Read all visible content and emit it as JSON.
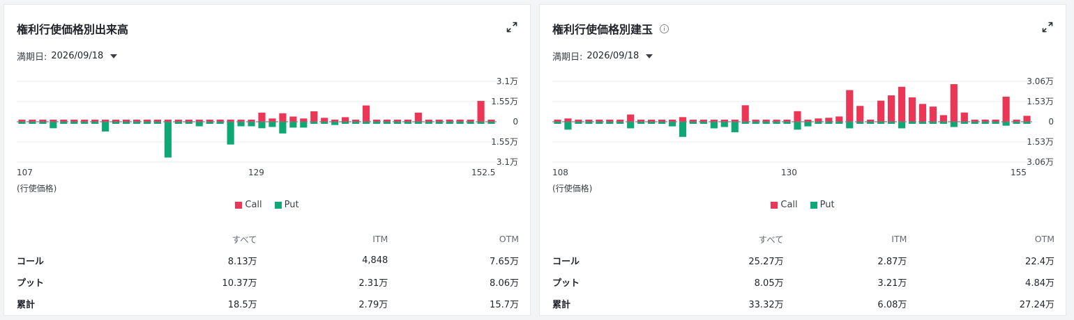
{
  "colors": {
    "call": "#ec3655",
    "put": "#0fa875",
    "grid": "#e9ebee",
    "zero": "#7a7f85"
  },
  "panels": [
    {
      "title": "権利行使価格別出来高",
      "has_info_icon": false,
      "expiry_label": "満期日:",
      "expiry_value": "2026/09/18",
      "x_unit": "(行使価格)",
      "legend_call": "Call",
      "legend_put": "Put",
      "table": {
        "headers": [
          "",
          "すべて",
          "ITM",
          "OTM"
        ],
        "rows": [
          {
            "label": "コール",
            "all": "8.13万",
            "itm": "4,848",
            "otm": "7.65万"
          },
          {
            "label": "プット",
            "all": "10.37万",
            "itm": "2.31万",
            "otm": "8.06万"
          },
          {
            "label": "累計",
            "all": "18.5万",
            "itm": "2.79万",
            "otm": "15.7万"
          }
        ]
      }
    },
    {
      "title": "権利行使価格別建玉",
      "has_info_icon": true,
      "expiry_label": "満期日:",
      "expiry_value": "2026/09/18",
      "x_unit": "(行使価格)",
      "legend_call": "Call",
      "legend_put": "Put",
      "table": {
        "headers": [
          "",
          "すべて",
          "ITM",
          "OTM"
        ],
        "rows": [
          {
            "label": "コール",
            "all": "25.27万",
            "itm": "2.87万",
            "otm": "22.4万"
          },
          {
            "label": "プット",
            "all": "8.05万",
            "itm": "3.21万",
            "otm": "4.84万"
          },
          {
            "label": "累計",
            "all": "33.32万",
            "itm": "6.08万",
            "otm": "27.24万"
          }
        ]
      }
    }
  ],
  "chart_data": [
    {
      "type": "bar",
      "title": "権利行使価格別出来高",
      "xlabel": "(行使価格)",
      "x_tick_labels": [
        "107",
        "129",
        "152.5"
      ],
      "y_tick_labels": [
        "3.1万",
        "1.55万",
        "0",
        "1.55万",
        "3.1万"
      ],
      "ylim": [
        -31000,
        31000
      ],
      "series": [
        {
          "name": "Call",
          "values": [
            0,
            0,
            0,
            0,
            0,
            0,
            0,
            0,
            0,
            0,
            0,
            0,
            0,
            0,
            0,
            0,
            0,
            0,
            0,
            0,
            0,
            0,
            0,
            7000,
            2500,
            6500,
            4000,
            2500,
            8000,
            3000,
            1500,
            3500,
            1000,
            12500,
            0,
            0,
            0,
            0,
            7000,
            0,
            0,
            0,
            0,
            0,
            16000,
            0
          ]
        },
        {
          "name": "Put",
          "values": [
            0,
            0,
            0,
            -5000,
            0,
            0,
            0,
            0,
            -7500,
            0,
            0,
            0,
            0,
            0,
            -27500,
            0,
            0,
            -3500,
            0,
            0,
            -17500,
            -3500,
            -3500,
            -5000,
            -4000,
            -9000,
            -4500,
            -4500,
            0,
            0,
            -2500,
            0,
            0,
            0,
            0,
            0,
            0,
            0,
            0,
            0,
            0,
            0,
            0,
            0,
            0,
            0
          ]
        }
      ]
    },
    {
      "type": "bar",
      "title": "権利行使価格別建玉",
      "xlabel": "(行使価格)",
      "x_tick_labels": [
        "108",
        "130",
        "155"
      ],
      "y_tick_labels": [
        "3.06万",
        "1.53万",
        "0",
        "1.53万",
        "3.06万"
      ],
      "ylim": [
        -30600,
        30600
      ],
      "series": [
        {
          "name": "Call",
          "values": [
            0,
            2500,
            0,
            0,
            0,
            0,
            0,
            5500,
            0,
            0,
            0,
            0,
            3500,
            0,
            0,
            0,
            0,
            0,
            12500,
            0,
            0,
            0,
            0,
            8000,
            0,
            2500,
            3000,
            4000,
            24000,
            12000,
            0,
            16000,
            20000,
            26500,
            18500,
            13500,
            11500,
            5000,
            28500,
            7000,
            0,
            0,
            0,
            19000,
            0,
            4500
          ]
        },
        {
          "name": "Put",
          "values": [
            0,
            -6000,
            0,
            0,
            0,
            0,
            0,
            -5000,
            0,
            0,
            0,
            -3500,
            -11500,
            0,
            0,
            -5000,
            -4000,
            -8000,
            0,
            0,
            0,
            0,
            0,
            -6000,
            -3500,
            0,
            0,
            0,
            -5000,
            0,
            0,
            0,
            0,
            -5000,
            0,
            0,
            0,
            0,
            -4000,
            0,
            0,
            0,
            0,
            -3000,
            0,
            0
          ]
        }
      ]
    }
  ]
}
